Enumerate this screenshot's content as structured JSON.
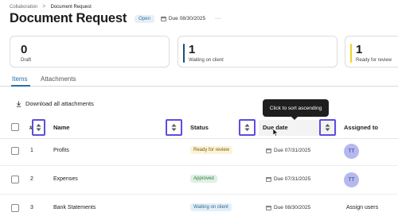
{
  "breadcrumb": {
    "parent": "Collaboration",
    "separator": ">",
    "current": "Document Request"
  },
  "header": {
    "title": "Document Request",
    "status": "Open",
    "due": "Due 08/30/2025",
    "more": "···"
  },
  "summary_cards": [
    {
      "value": "0",
      "label": "Draft",
      "color": "#ffffff"
    },
    {
      "value": "1",
      "label": "Waiting on client",
      "color": "#1f4e7a"
    },
    {
      "value": "1",
      "label": "Ready for review",
      "color": "#f2cf2b"
    }
  ],
  "tabs": [
    {
      "label": "Items",
      "active": true
    },
    {
      "label": "Attachments",
      "active": false
    }
  ],
  "download_label": "Download all attachments",
  "tooltip": "Click to sort ascending",
  "table": {
    "columns": {
      "number": "#",
      "name": "Name",
      "status": "Status",
      "due": "Due date",
      "assigned": "Assigned to"
    },
    "rows": [
      {
        "number": "1",
        "name": "Profits",
        "status": "Ready for review",
        "status_kind": "review",
        "due": "Due 07/31/2025",
        "assigned": "TT"
      },
      {
        "number": "2",
        "name": "Expenses",
        "status": "Approved",
        "status_kind": "approved",
        "due": "Due 07/31/2025",
        "assigned": "TT"
      },
      {
        "number": "3",
        "name": "Bank Statements",
        "status": "Waiting on client",
        "status_kind": "waiting",
        "due": "Due 08/30/2025",
        "assigned": "Assign users"
      }
    ]
  },
  "icons": {
    "sort": "sort-updown-icon",
    "calendar": "calendar-icon",
    "download": "download-icon",
    "cursor": "mouse-pointer-icon"
  },
  "colors": {
    "accent": "#2a6fa8",
    "highlight": "#5c4ee0",
    "avatar": "#b6b9ef"
  }
}
